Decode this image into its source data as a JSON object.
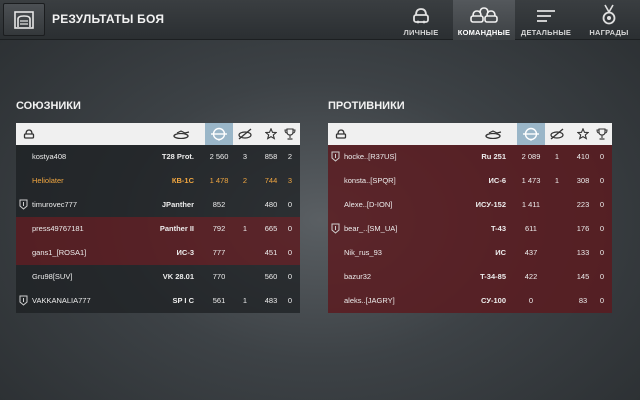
{
  "header": {
    "title": "РЕЗУЛЬТАТЫ БОЯ",
    "tabs": [
      {
        "label": "ЛИЧНЫЕ",
        "icon": "personal-tank-icon",
        "active": false
      },
      {
        "label": "КОМАНДНЫЕ",
        "icon": "team-tanks-icon",
        "active": true
      },
      {
        "label": "ДЕТАЛЬНЫЕ",
        "icon": "list-lines-icon",
        "active": false
      },
      {
        "label": "НАГРАДЫ",
        "icon": "medal-icon",
        "active": false
      }
    ]
  },
  "colors": {
    "highlight_player": "#f0a640",
    "enemy_row": "#5c1a1e",
    "ally_row": "#1c1e21",
    "selected_column": "#9ab6c8"
  },
  "columns": [
    "player-icon",
    "tank-icon",
    "damage-icon",
    "kills-icon",
    "xp-star-icon",
    "trophy-icon"
  ],
  "allies": {
    "title": "СОЮЗНИКИ",
    "rows": [
      {
        "name": "kostya408",
        "vehicle": "T28 Prot.",
        "damage": "2 560",
        "kills": "3",
        "xp": "858",
        "rank": "2",
        "row": "dark",
        "badge": false,
        "me": false
      },
      {
        "name": "Heliolater",
        "vehicle": "КВ-1С",
        "damage": "1 478",
        "kills": "2",
        "xp": "744",
        "rank": "3",
        "row": "dark",
        "badge": false,
        "me": true
      },
      {
        "name": "timurovec777",
        "vehicle": "JPanther",
        "damage": "852",
        "kills": "",
        "xp": "480",
        "rank": "0",
        "row": "dark",
        "badge": true,
        "me": false
      },
      {
        "name": "press49767181",
        "vehicle": "Panther II",
        "damage": "792",
        "kills": "1",
        "xp": "665",
        "rank": "0",
        "row": "red",
        "badge": false,
        "me": false
      },
      {
        "name": "gans1_[ROSA1]",
        "vehicle": "ИС-3",
        "damage": "777",
        "kills": "",
        "xp": "451",
        "rank": "0",
        "row": "red",
        "badge": false,
        "me": false
      },
      {
        "name": "Gru98[SUV]",
        "vehicle": "VK 28.01",
        "damage": "770",
        "kills": "",
        "xp": "560",
        "rank": "0",
        "row": "dark",
        "badge": false,
        "me": false
      },
      {
        "name": "VAKKANALIA777",
        "vehicle": "SP I C",
        "damage": "561",
        "kills": "1",
        "xp": "483",
        "rank": "0",
        "row": "dark",
        "badge": true,
        "me": false
      }
    ]
  },
  "enemies": {
    "title": "ПРОТИВНИКИ",
    "rows": [
      {
        "name": "hocke..[R37US]",
        "vehicle": "Ru 251",
        "damage": "2 089",
        "kills": "1",
        "xp": "410",
        "rank": "0",
        "row": "red",
        "badge": true,
        "me": false
      },
      {
        "name": "konsta..[SPQR]",
        "vehicle": "ИС-6",
        "damage": "1 473",
        "kills": "1",
        "xp": "308",
        "rank": "0",
        "row": "red",
        "badge": false,
        "me": false
      },
      {
        "name": "Alexe..[D-ION]",
        "vehicle": "ИСУ-152",
        "damage": "1 411",
        "kills": "",
        "xp": "223",
        "rank": "0",
        "row": "red",
        "badge": false,
        "me": false
      },
      {
        "name": "bear_..[SM_UA]",
        "vehicle": "T-43",
        "damage": "611",
        "kills": "",
        "xp": "176",
        "rank": "0",
        "row": "red",
        "badge": true,
        "me": false
      },
      {
        "name": "Nik_rus_93",
        "vehicle": "ИС",
        "damage": "437",
        "kills": "",
        "xp": "133",
        "rank": "0",
        "row": "red",
        "badge": false,
        "me": false
      },
      {
        "name": "bazur32",
        "vehicle": "T-34-85",
        "damage": "422",
        "kills": "",
        "xp": "145",
        "rank": "0",
        "row": "red",
        "badge": false,
        "me": false
      },
      {
        "name": "aleks..[JAGRY]",
        "vehicle": "СУ-100",
        "damage": "0",
        "kills": "",
        "xp": "83",
        "rank": "0",
        "row": "red",
        "badge": false,
        "me": false
      }
    ]
  }
}
